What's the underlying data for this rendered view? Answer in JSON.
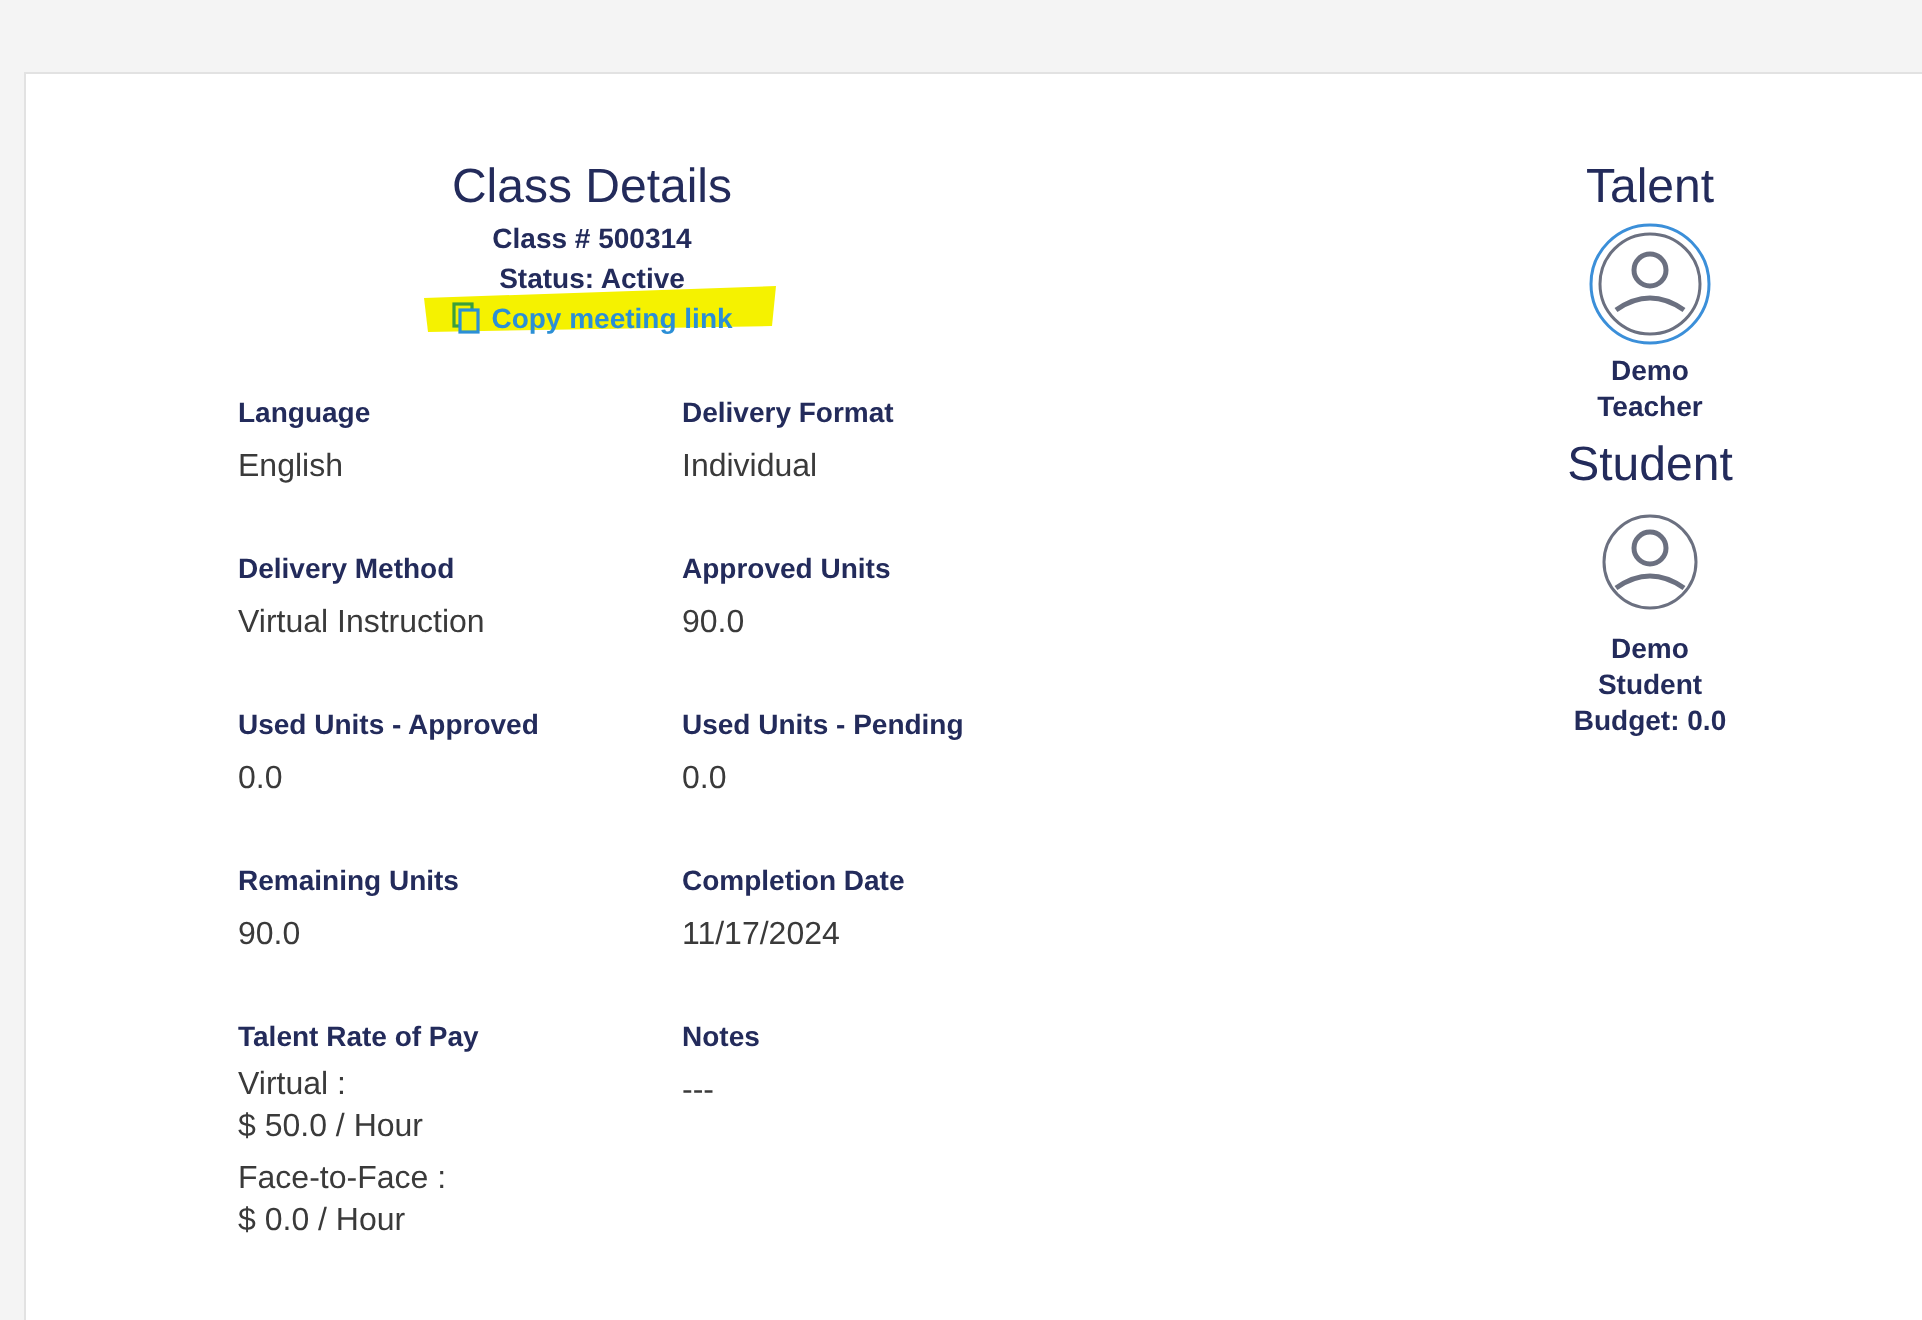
{
  "header": {
    "title": "Class Details",
    "class_number": "Class # 500314",
    "status": "Status: Active",
    "copy_link": {
      "label": "Copy meeting link",
      "highlighted": true
    }
  },
  "fields": [
    {
      "kind": "text",
      "label": "Language",
      "value": "English"
    },
    {
      "kind": "text",
      "label": "Delivery Format",
      "value": "Individual"
    },
    {
      "kind": "text",
      "label": "Delivery Method",
      "value": "Virtual Instruction"
    },
    {
      "kind": "text",
      "label": "Approved Units",
      "value": "90.0"
    },
    {
      "kind": "text",
      "label": "Used Units - Approved",
      "value": "0.0"
    },
    {
      "kind": "text",
      "label": "Used Units - Pending",
      "value": "0.0"
    },
    {
      "kind": "text",
      "label": "Remaining Units",
      "value": "90.0"
    },
    {
      "kind": "text",
      "label": "Completion Date",
      "value": "11/17/2024"
    },
    {
      "kind": "rates",
      "label": "Talent Rate of Pay",
      "rates": [
        {
          "label": "Virtual :",
          "amount": "$ 50.0 / Hour"
        },
        {
          "label": "Face-to-Face :",
          "amount": "$ 0.0 / Hour"
        }
      ]
    },
    {
      "kind": "text",
      "label": "Notes",
      "value": "---"
    }
  ],
  "people": [
    {
      "heading": "Talent",
      "selected": true,
      "lines": [
        "Demo",
        "Teacher"
      ]
    },
    {
      "heading": "Student",
      "selected": false,
      "lines": [
        "Demo",
        "Student",
        "Budget: 0.0"
      ]
    }
  ]
}
